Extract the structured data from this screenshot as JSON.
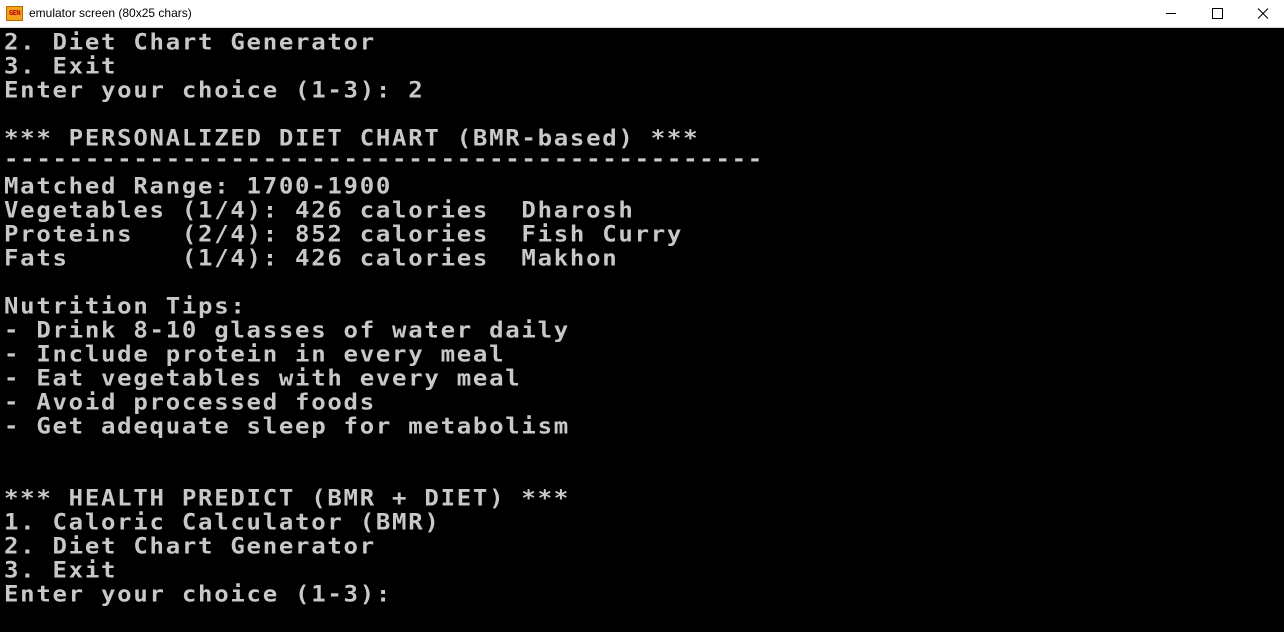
{
  "window": {
    "icon_text": "GEN",
    "title": "emulator screen (80x25 chars)"
  },
  "controls": {
    "minimize_icon": "minimize-icon",
    "maximize_icon": "maximize-icon",
    "close_icon": "close-icon"
  },
  "console": {
    "lines": [
      "2. Diet Chart Generator",
      "3. Exit",
      "Enter your choice (1-3): 2",
      "",
      "*** PERSONALIZED DIET CHART (BMR-based) ***",
      "-----------------------------------------------",
      "Matched Range: 1700-1900",
      "Vegetables (1/4): 426 calories  Dharosh",
      "Proteins   (2/4): 852 calories  Fish Curry",
      "Fats       (1/4): 426 calories  Makhon",
      "",
      "Nutrition Tips:",
      "- Drink 8-10 glasses of water daily",
      "- Include protein in every meal",
      "- Eat vegetables with every meal",
      "- Avoid processed foods",
      "- Get adequate sleep for metabolism",
      "",
      "",
      "*** HEALTH PREDICT (BMR + DIET) ***",
      "1. Caloric Calculator (BMR)",
      "2. Diet Chart Generator",
      "3. Exit",
      "Enter your choice (1-3):",
      ""
    ]
  },
  "colors": {
    "background": "#000000",
    "text": "#c8c8c8",
    "titlebar": "#ffffff"
  }
}
